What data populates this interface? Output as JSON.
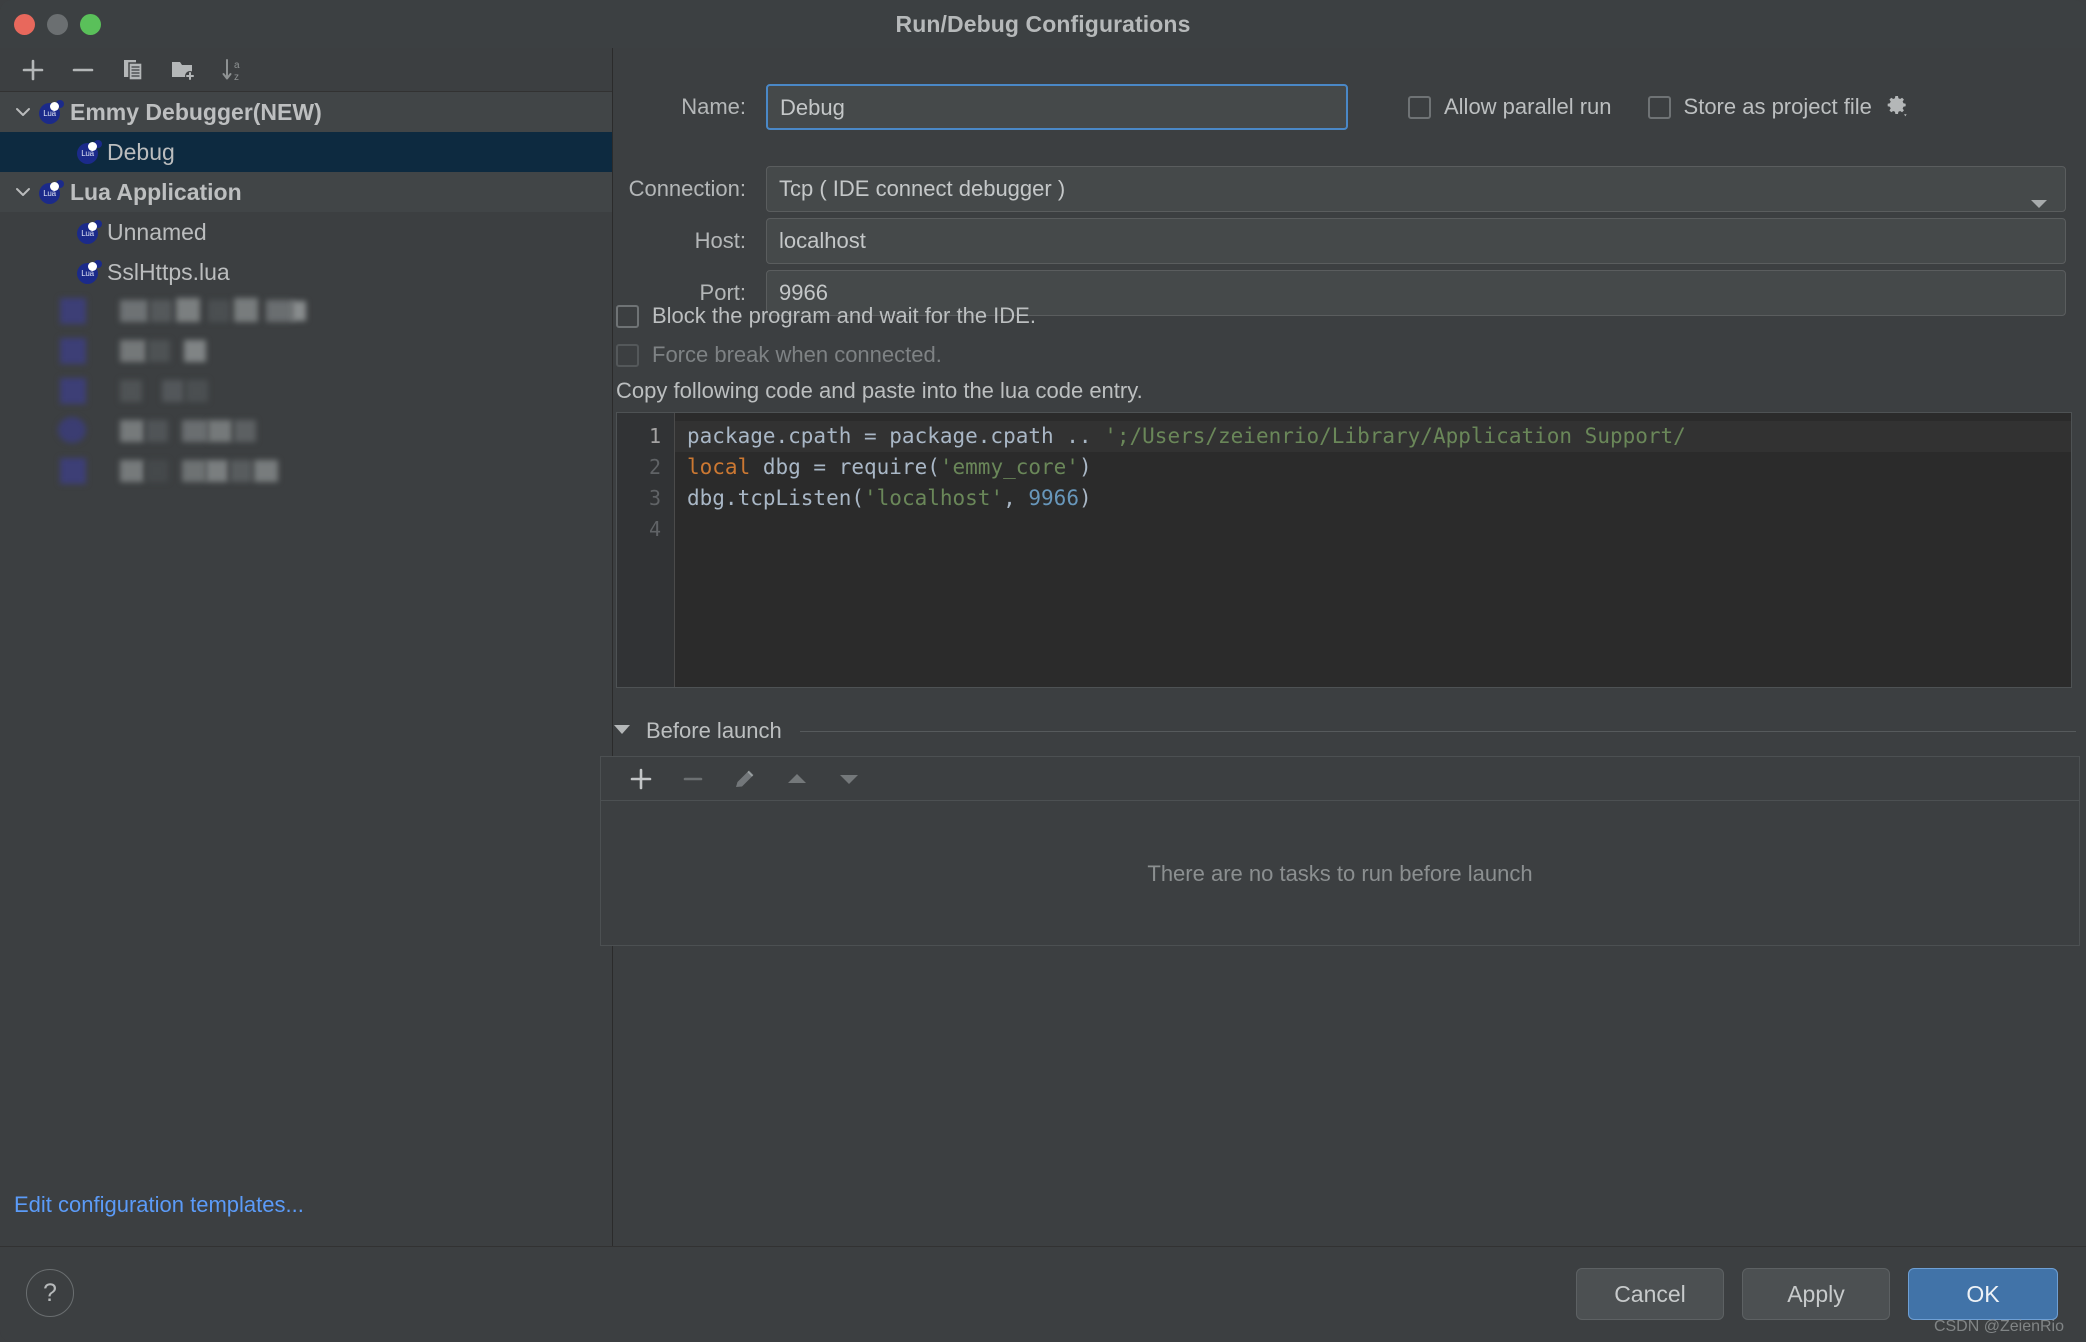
{
  "window": {
    "title": "Run/Debug Configurations",
    "traffic_lights": [
      "close",
      "minimize",
      "maximize"
    ]
  },
  "sidebar": {
    "toolbar": [
      {
        "name": "add",
        "icon": "plus-icon"
      },
      {
        "name": "remove",
        "icon": "minus-icon"
      },
      {
        "name": "copy",
        "icon": "copy-icon"
      },
      {
        "name": "save-as-folder",
        "icon": "folder-add-icon"
      },
      {
        "name": "sort-alphabetically",
        "icon": "sort-az-icon"
      }
    ],
    "tree": [
      {
        "label": "Emmy Debugger(NEW)",
        "type": "group",
        "expanded": true
      },
      {
        "label": "Debug",
        "type": "child",
        "selected": true
      },
      {
        "label": "Lua Application",
        "type": "group",
        "expanded": true
      },
      {
        "label": "Unnamed",
        "type": "child",
        "selected": false
      },
      {
        "label": "SslHttps.lua",
        "type": "child",
        "selected": false
      },
      {
        "label": "",
        "type": "censored"
      },
      {
        "label": "",
        "type": "censored"
      },
      {
        "label": "",
        "type": "censored"
      },
      {
        "label": "",
        "type": "censored"
      },
      {
        "label": "",
        "type": "censored"
      }
    ],
    "edit_templates_link": "Edit configuration templates..."
  },
  "form": {
    "name_label": "Name:",
    "name_value": "Debug",
    "allow_parallel_run": {
      "label": "Allow parallel run",
      "checked": false
    },
    "store_as_project_file": {
      "label": "Store as project file",
      "checked": false
    },
    "gear_icon": "gear-icon",
    "connection_label": "Connection:",
    "connection_value": "Tcp ( IDE connect debugger )",
    "host_label": "Host:",
    "host_value": "localhost",
    "port_label": "Port:",
    "port_value": "9966",
    "block_program": {
      "label": "Block the program and wait for the IDE.",
      "checked": false,
      "disabled": false
    },
    "force_break": {
      "label": "Force break when connected.",
      "checked": false,
      "disabled": true
    },
    "copy_hint": "Copy following code and paste into the lua code entry."
  },
  "code": {
    "line_numbers": [
      "1",
      "2",
      "3",
      "4"
    ],
    "lines": [
      {
        "n": 1,
        "highlighted": true,
        "tokens": [
          {
            "t": "package.cpath = package.cpath .. ",
            "k": "plain"
          },
          {
            "t": "';/Users/zeienrio/Library/Application Support/",
            "k": "str"
          }
        ]
      },
      {
        "n": 2,
        "highlighted": false,
        "tokens": [
          {
            "t": "local",
            "k": "kw"
          },
          {
            "t": " dbg = require(",
            "k": "plain"
          },
          {
            "t": "'emmy_core'",
            "k": "str"
          },
          {
            "t": ")",
            "k": "plain"
          }
        ]
      },
      {
        "n": 3,
        "highlighted": false,
        "tokens": [
          {
            "t": "dbg.tcpListen(",
            "k": "plain"
          },
          {
            "t": "'localhost'",
            "k": "str"
          },
          {
            "t": ", ",
            "k": "plain"
          },
          {
            "t": "9966",
            "k": "num"
          },
          {
            "t": ")",
            "k": "plain"
          }
        ]
      },
      {
        "n": 4,
        "highlighted": false,
        "tokens": []
      }
    ]
  },
  "before_launch": {
    "title": "Before launch",
    "expanded": true,
    "toolbar": [
      {
        "name": "add-task",
        "icon": "plus-icon",
        "enabled": true
      },
      {
        "name": "remove-task",
        "icon": "minus-icon",
        "enabled": false
      },
      {
        "name": "edit-task",
        "icon": "pencil-icon",
        "enabled": false
      },
      {
        "name": "move-up",
        "icon": "arrow-up-icon",
        "enabled": false
      },
      {
        "name": "move-down",
        "icon": "arrow-down-icon",
        "enabled": false
      }
    ],
    "empty_text": "There are no tasks to run before launch"
  },
  "footer": {
    "help": "?",
    "cancel": "Cancel",
    "apply": "Apply",
    "ok": "OK",
    "watermark": "CSDN @ZeienRio"
  },
  "colors": {
    "background": "#3c3f41",
    "selection": "#0d2a40",
    "accent": "#4173a8",
    "link": "#5b9bf8",
    "editor_bg": "#2b2b2b",
    "string_token": "#6a8759",
    "keyword_token": "#cc7832",
    "number_token": "#6897bb"
  }
}
